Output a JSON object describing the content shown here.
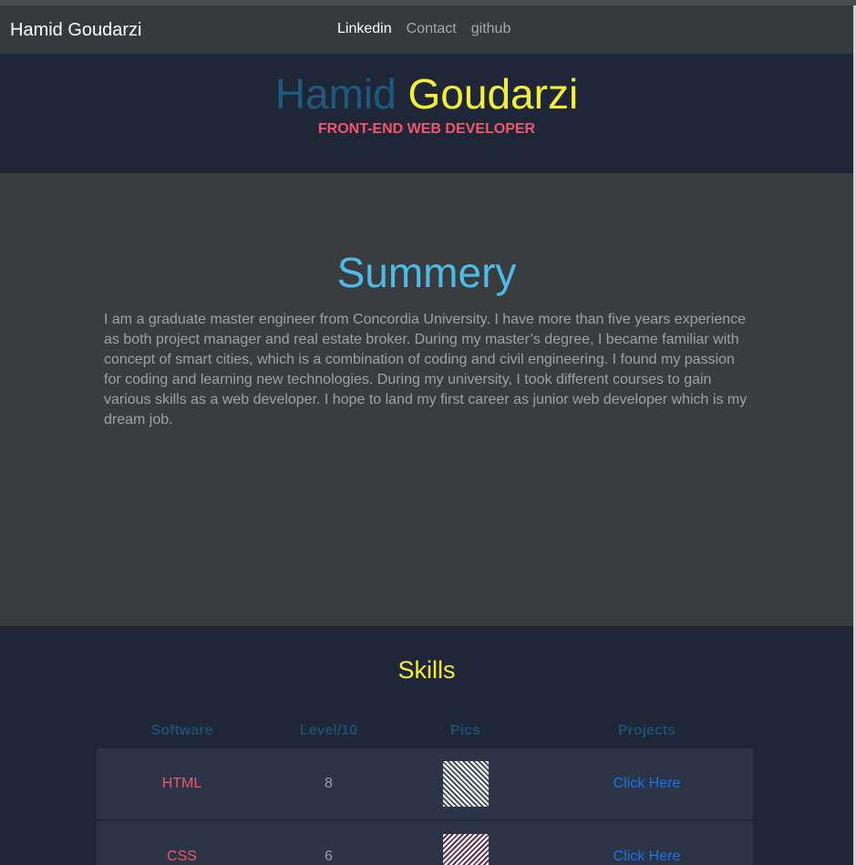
{
  "nav": {
    "brand": "Hamid Goudarzi",
    "links": [
      "Linkedin",
      "Contact",
      "github"
    ]
  },
  "hero": {
    "first_name": "Hamid",
    "last_name": "Goudarzi",
    "subtitle": "FRONT-END WEB DEVELOPER"
  },
  "summary": {
    "title": "Summery",
    "text": "I am a graduate master engineer from Concordia University. I have more than five years experience as both project manager and real estate broker. During my master’s degree, I became familiar with concept of smart cities, which is a combination of coding and civil engineering. I found my passion for coding and learning new technologies. During my university, I took different courses to gain various skills as a web developer. I hope to land my first career as junior web developer which is my dream job."
  },
  "skills": {
    "title": "Skills",
    "headers": [
      "Software",
      "Level/10",
      "Pics",
      "Projects"
    ],
    "rows": [
      {
        "software": "HTML",
        "level": "8",
        "pic": "html-thumbnail",
        "project": "Click Here"
      },
      {
        "software": "CSS",
        "level": "6",
        "pic": "css-thumbnail",
        "project": "Click Here"
      }
    ]
  },
  "colors": {
    "hero_bg": "#1e2638",
    "summary_bg": "#3a3c3d",
    "accent_yellow": "#f5f032",
    "accent_red": "#f2566b",
    "accent_blue": "#4bbbe8",
    "link_blue": "#1a73e8"
  }
}
